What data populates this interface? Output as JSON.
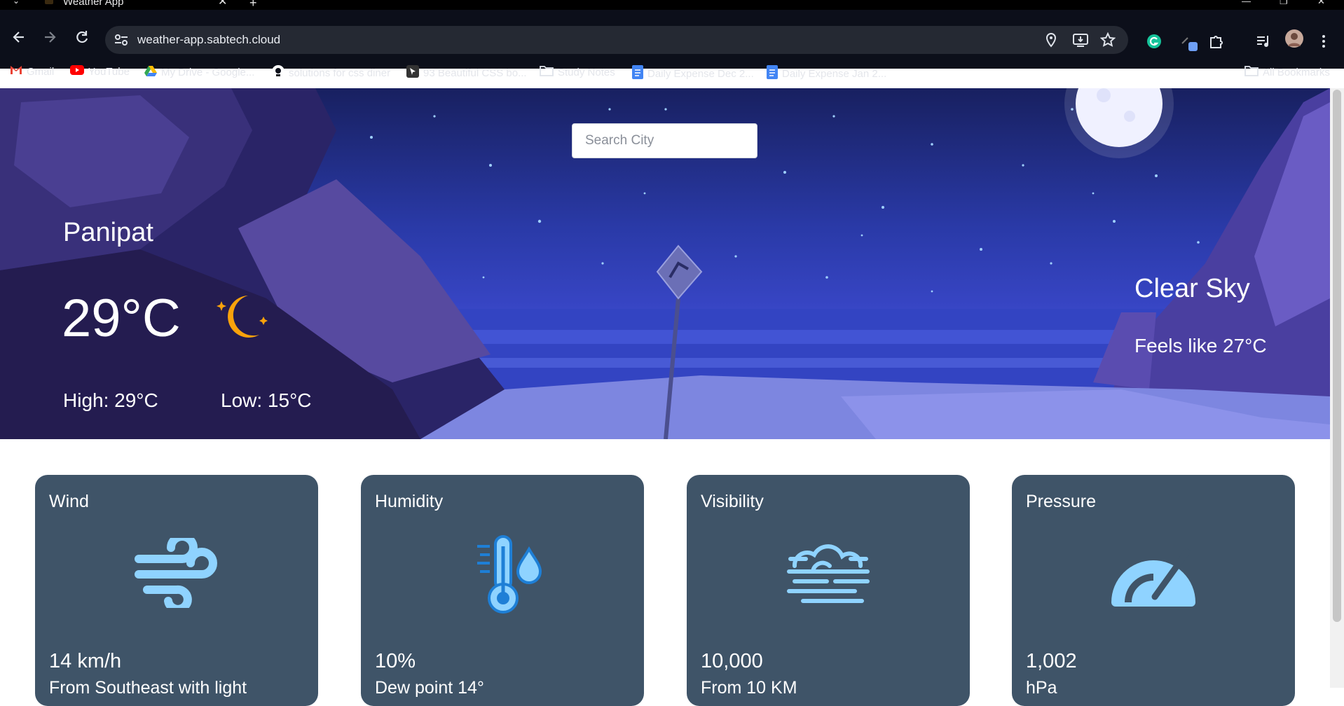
{
  "browser": {
    "tab_title": "Weather App",
    "url": "weather-app.sabtech.cloud",
    "bookmarks": [
      {
        "label": "Gmail",
        "color": "#ea4335"
      },
      {
        "label": "YouTube",
        "color": "#ff0000"
      },
      {
        "label": "My Drive - Google...",
        "color": "#34a853"
      },
      {
        "label": "solutions for css diner",
        "color": "#ffffff"
      },
      {
        "label": "93 Beautiful CSS bo...",
        "color": "#444444"
      },
      {
        "label": "Study Notes",
        "color": "folder"
      },
      {
        "label": "Daily Expense Dec 2...",
        "color": "#4285f4"
      },
      {
        "label": "Daily Expense Jan 2...",
        "color": "#4285f4"
      }
    ],
    "all_bookmarks": "All Bookmarks"
  },
  "search": {
    "placeholder": "Search City"
  },
  "weather": {
    "city": "Panipat",
    "temperature": "29°C",
    "high": "High: 29°C",
    "low": "Low: 15°C",
    "condition": "Clear Sky",
    "feels_like": "Feels like 27°C",
    "icon": "moon-stars-icon"
  },
  "cards": [
    {
      "title": "Wind",
      "value": "14 km/h",
      "sub": "From Southeast with light",
      "icon": "wind-icon"
    },
    {
      "title": "Humidity",
      "value": "10%",
      "sub": "Dew point 14°",
      "icon": "thermometer-droplet-icon"
    },
    {
      "title": "Visibility",
      "value": "10,000",
      "sub": "From 10 KM",
      "icon": "fog-icon"
    },
    {
      "title": "Pressure",
      "value": "1,002",
      "sub": "hPa",
      "icon": "gauge-icon"
    }
  ],
  "colors": {
    "card_bg": "#3f5468",
    "icon_blue": "#8fd3ff",
    "moon": "#f9a20b"
  }
}
